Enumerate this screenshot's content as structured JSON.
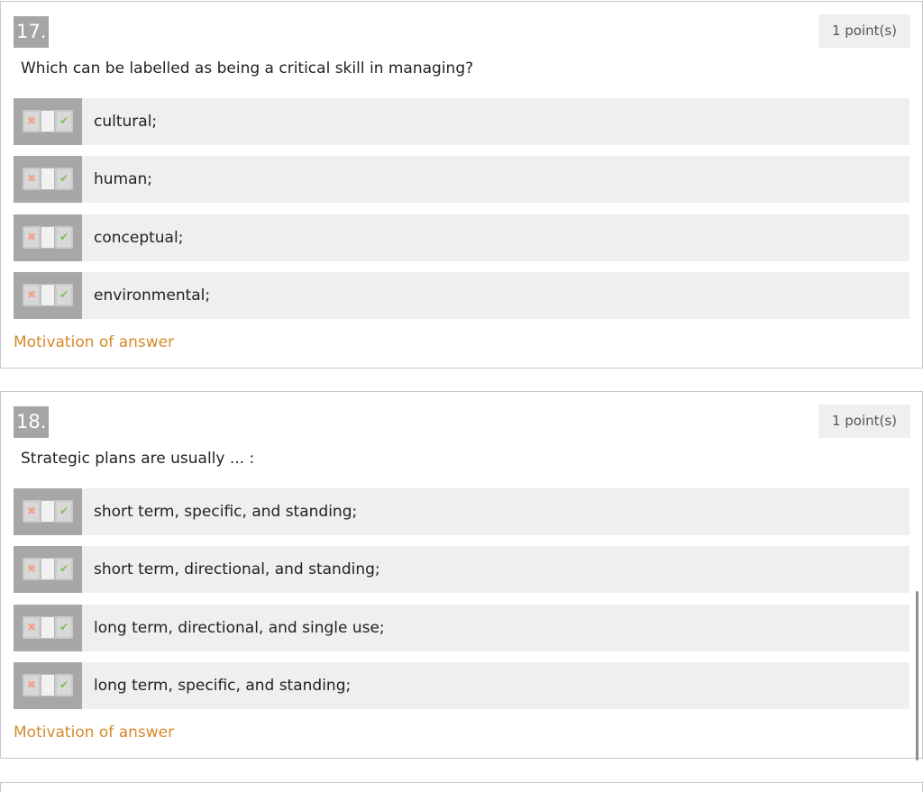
{
  "questions": [
    {
      "number": "17.",
      "points": "1 point(s)",
      "text": "Which can be labelled as being a critical skill in managing?",
      "options": [
        "cultural;",
        "human;",
        "conceptual;",
        "environmental;"
      ],
      "motivation": "Motivation of answer"
    },
    {
      "number": "18.",
      "points": "1 point(s)",
      "text": "Strategic plans are usually ... :",
      "options": [
        "short term, specific, and standing;",
        "short term, directional, and standing;",
        "long term, directional, and single use;",
        "long term, specific, and standing;"
      ],
      "motivation": "Motivation of answer"
    }
  ],
  "icons": {
    "no": "✖",
    "yes": "✔"
  },
  "colors": {
    "accent": "#d58a2c",
    "option_bg": "#efefef",
    "toggle_bg": "#a7a7a7",
    "number_bg": "#a5a5a5"
  }
}
